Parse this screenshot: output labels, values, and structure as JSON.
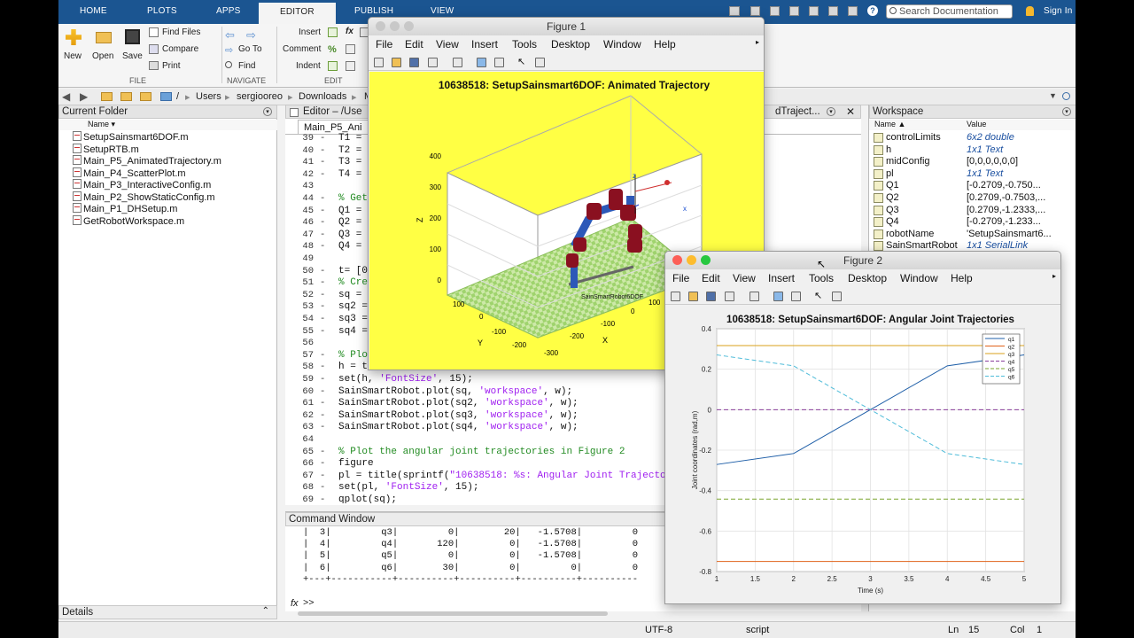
{
  "tabs": [
    "HOME",
    "PLOTS",
    "APPS",
    "EDITOR",
    "PUBLISH",
    "VIEW"
  ],
  "search_placeholder": "Search Documentation",
  "sign_in": "Sign In",
  "ribbon": {
    "new": "New",
    "open": "Open",
    "save": "Save",
    "find_files": "Find Files",
    "compare": "Compare",
    "print": "Print",
    "go_to": "Go To",
    "find": "Find",
    "insert": "Insert",
    "comment": "Comment",
    "indent": "Indent",
    "fx": "fx",
    "group_file": "FILE",
    "group_navigate": "NAVIGATE",
    "group_edit": "EDIT"
  },
  "path": [
    "/",
    "Users",
    "sergiooreo",
    "Downloads",
    "M"
  ],
  "current_folder": {
    "title": "Current Folder",
    "col_name": "Name ▾",
    "files": [
      "SetupSainsmart6DOF.m",
      "SetupRTB.m",
      "Main_P5_AnimatedTrajectory.m",
      "Main_P4_ScatterPlot.m",
      "Main_P3_InteractiveConfig.m",
      "Main_P2_ShowStaticConfig.m",
      "Main_P1_DHSetup.m",
      "GetRobotWorkspace.m"
    ],
    "details": "Details"
  },
  "editor": {
    "title": "Editor – /Use",
    "tab": "Main_P5_Ani",
    "tab2": "dTraject...",
    "lines": [
      {
        "n": "39",
        "code": "T1 = t"
      },
      {
        "n": "40",
        "code": "T2 = t"
      },
      {
        "n": "41",
        "code": "T3 = t"
      },
      {
        "n": "42",
        "code": "T4 = t"
      },
      {
        "n": "43",
        "code": ""
      },
      {
        "n": "44",
        "code": "% Get "
      },
      {
        "n": "45",
        "code": "Q1 = Sa"
      },
      {
        "n": "46",
        "code": "Q2 = Sa"
      },
      {
        "n": "47",
        "code": "Q3 = Sa"
      },
      {
        "n": "48",
        "code": "Q4 = Sa"
      },
      {
        "n": "49",
        "code": ""
      },
      {
        "n": "50",
        "code": "t= [0:"
      },
      {
        "n": "51",
        "code": "% Crea"
      },
      {
        "n": "52",
        "code": "sq = j"
      },
      {
        "n": "53",
        "code": "sq2 = "
      },
      {
        "n": "54",
        "code": "sq3 = "
      },
      {
        "n": "55",
        "code": "sq4 = "
      },
      {
        "n": "56",
        "code": ""
      },
      {
        "n": "57",
        "code": "% Plot"
      },
      {
        "n": "58",
        "code": "h = tit"
      },
      {
        "n": "59",
        "code": "set(h, 'FontSize', 15);"
      },
      {
        "n": "60",
        "code": "SainSmartRobot.plot(sq, 'workspace', w);"
      },
      {
        "n": "61",
        "code": "SainSmartRobot.plot(sq2, 'workspace', w);"
      },
      {
        "n": "62",
        "code": "SainSmartRobot.plot(sq3, 'workspace', w);"
      },
      {
        "n": "63",
        "code": "SainSmartRobot.plot(sq4, 'workspace', w);"
      },
      {
        "n": "64",
        "code": ""
      },
      {
        "n": "65",
        "code": "% Plot the angular joint trajectories in Figure 2"
      },
      {
        "n": "66",
        "code": "figure"
      },
      {
        "n": "67",
        "code": "pl = title(sprintf(\"10638518: %s: Angular Joint Trajectorie"
      },
      {
        "n": "68",
        "code": "set(pl, 'FontSize', 15);"
      },
      {
        "n": "69",
        "code": "qplot(sq);"
      }
    ]
  },
  "command_window": {
    "title": "Command Window",
    "rows": [
      "|  3|         q3|         0|        20|   -1.5708|         0",
      "|  4|         q4|       120|         0|   -1.5708|         0",
      "|  5|         q5|         0|         0|   -1.5708|         0",
      "|  6|         q6|        30|         0|         0|         0",
      "+---+-----------+----------+----------+----------+----------"
    ],
    "prompt": ">>",
    "fx": "fx"
  },
  "workspace": {
    "title": "Workspace",
    "col_name": "Name ▲",
    "col_value": "Value",
    "vars": [
      {
        "name": "controlLimits",
        "value": "6x2 double",
        "italic": true
      },
      {
        "name": "h",
        "value": "1x1 Text",
        "italic": true
      },
      {
        "name": "midConfig",
        "value": "[0,0,0,0,0,0]",
        "italic": false
      },
      {
        "name": "pl",
        "value": "1x1 Text",
        "italic": true
      },
      {
        "name": "Q1",
        "value": "[-0.2709,-0.750...",
        "italic": false
      },
      {
        "name": "Q2",
        "value": "[0.2709,-0.7503,...",
        "italic": false
      },
      {
        "name": "Q3",
        "value": "[0.2709,-1.2333,...",
        "italic": false
      },
      {
        "name": "Q4",
        "value": "[-0.2709,-1.233...",
        "italic": false
      },
      {
        "name": "robotName",
        "value": "'SetupSainsmart6...",
        "italic": false
      },
      {
        "name": "SainSmartRobot",
        "value": "1x1 SerialLink",
        "italic": true
      }
    ]
  },
  "status": {
    "encoding": "UTF-8",
    "type": "script",
    "ln_label": "Ln",
    "ln": "15",
    "col_label": "Col",
    "col": "1"
  },
  "figure1": {
    "window_title": "Figure 1",
    "menus": [
      "File",
      "Edit",
      "View",
      "Insert",
      "Tools",
      "Desktop",
      "Window",
      "Help"
    ],
    "plot_title": "10638518: SetupSainsmart6DOF: Animated Trajectory",
    "robot_label": "SainSmartRobot6DOF",
    "z_label": "Z",
    "y_label": "Y",
    "x_label": "X",
    "z_ticks": [
      "400",
      "300",
      "200",
      "100",
      "0"
    ],
    "y_ticks": [
      "100",
      "0",
      "-100",
      "-200"
    ],
    "x_ticks": [
      "-200",
      "-100",
      "0",
      "100",
      "200",
      "-300"
    ],
    "axis_x": "x",
    "axis_z": "z",
    "bg_color": "#ffff44"
  },
  "figure2": {
    "window_title": "Figure 2",
    "menus": [
      "File",
      "Edit",
      "View",
      "Insert",
      "Tools",
      "Desktop",
      "Window",
      "Help"
    ]
  },
  "chart_data": {
    "type": "line",
    "title": "10638518: SetupSainsmart6DOF: Angular Joint Trajectories",
    "xlabel": "Time (s)",
    "ylabel": "Joint coordinates (rad,m)",
    "xlim": [
      1,
      5
    ],
    "ylim": [
      -0.8,
      0.4
    ],
    "x_ticks": [
      "1",
      "1.5",
      "2",
      "2.5",
      "3",
      "3.5",
      "4",
      "4.5",
      "5"
    ],
    "y_ticks": [
      "0.4",
      "0.2",
      "0",
      "-0.2",
      "-0.4",
      "-0.6",
      "-0.8"
    ],
    "grid": true,
    "legend_position": "top-right",
    "x": [
      1,
      2,
      3,
      4,
      5
    ],
    "series": [
      {
        "name": "q1",
        "color": "#1f5fa8",
        "dash": "solid",
        "values": [
          -0.2709,
          -0.2167,
          0,
          0.2167,
          0.2709
        ]
      },
      {
        "name": "q2",
        "color": "#e0621a",
        "dash": "solid",
        "values": [
          -0.7503,
          -0.7503,
          -0.7503,
          -0.7503,
          -0.7503
        ]
      },
      {
        "name": "q3",
        "color": "#d9a21b",
        "dash": "solid",
        "values": [
          0.3167,
          0.3167,
          0.3167,
          0.3167,
          0.3167
        ]
      },
      {
        "name": "q4",
        "color": "#8a3f9c",
        "dash": "dashed",
        "values": [
          0,
          0,
          0,
          0,
          0
        ]
      },
      {
        "name": "q5",
        "color": "#7aa52e",
        "dash": "dashed",
        "values": [
          -0.4418,
          -0.4418,
          -0.4418,
          -0.4418,
          -0.4418
        ]
      },
      {
        "name": "q6",
        "color": "#4fbcd9",
        "dash": "dashed",
        "values": [
          0.2709,
          0.2167,
          0,
          -0.2167,
          -0.2709
        ]
      }
    ]
  }
}
